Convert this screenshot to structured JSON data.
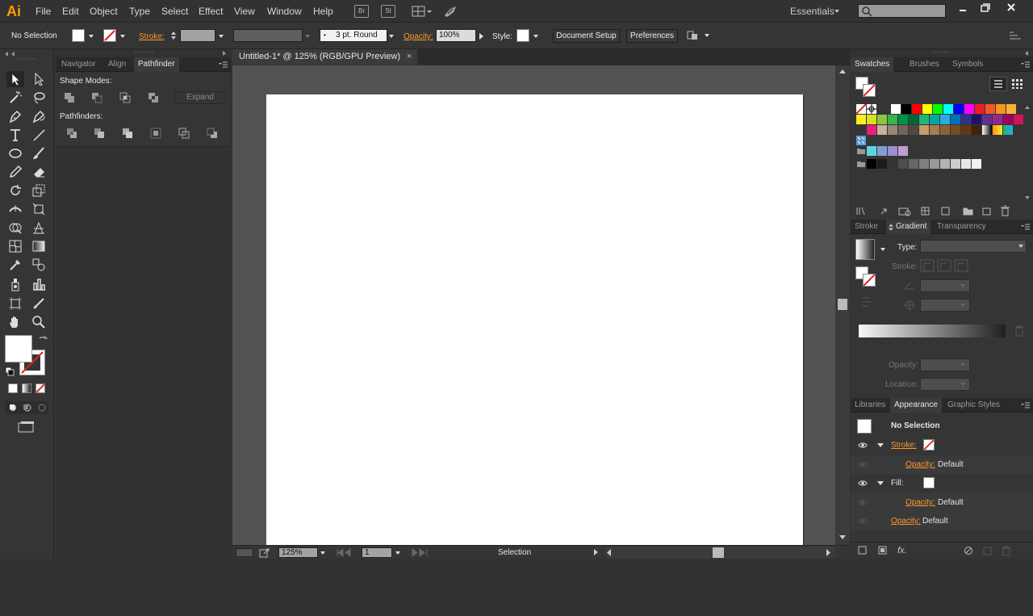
{
  "app": {
    "logo": "Ai"
  },
  "menu": [
    "File",
    "Edit",
    "Object",
    "Type",
    "Select",
    "Effect",
    "View",
    "Window",
    "Help"
  ],
  "menubar_icons": {
    "bridge": "Br",
    "stock": "St"
  },
  "workspace": "Essentials",
  "control": {
    "selection_label": "No Selection",
    "stroke_label": "Stroke:",
    "brush_label": "3 pt. Round",
    "opacity_label": "Opacity:",
    "opacity_value": "100%",
    "style_label": "Style:",
    "document_setup": "Document Setup",
    "preferences": "Preferences"
  },
  "left_panel": {
    "tabs": [
      "Navigator",
      "Align",
      "Pathfinder"
    ],
    "active_tab": "Pathfinder",
    "shape_modes_label": "Shape Modes:",
    "expand_label": "Expand",
    "pathfinders_label": "Pathfinders:"
  },
  "document": {
    "tab_title": "Untitled-1* @ 125% (RGB/GPU Preview)",
    "close": "×"
  },
  "status": {
    "zoom": "125%",
    "artboard": "1",
    "tool": "Selection"
  },
  "swatches_panel": {
    "tabs": [
      "Swatches",
      "Brushes",
      "Symbols"
    ],
    "active_tab": "Swatches",
    "rows": [
      [
        "#ffffff",
        "#000000",
        "#ff0000",
        "#ffff00",
        "#00ff00",
        "#00ffff",
        "#0000ff",
        "#ff00ff",
        "#ed1c24",
        "#f15a24",
        "#f7931e",
        "#fbb03b"
      ],
      [
        "#fcee21",
        "#d9e021",
        "#8cc63f",
        "#39b54a",
        "#009245",
        "#006837",
        "#22b573",
        "#00a99d",
        "#29abe2",
        "#0071bc",
        "#2e3192",
        "#1b1464",
        "#662d91",
        "#93278f",
        "#9e005d",
        "#d4145a"
      ],
      [
        "#ed1e79",
        "#c7b299",
        "#998675",
        "#736357",
        "#534741",
        "#c69c6d",
        "#a67c52",
        "#8c6239",
        "#754c24",
        "#603813",
        "#42210b",
        "#bdccd4"
      ],
      [
        "#5ed3de",
        "#7e9fd6",
        "#9b8fd1",
        "#c49cd6"
      ],
      [
        "#000000",
        "#1a1a1a",
        "#333333",
        "#4d4d4d",
        "#666666",
        "#808080",
        "#999999",
        "#b3b3b3",
        "#cccccc",
        "#e6e6e6",
        "#f2f2f2"
      ]
    ]
  },
  "gradient_panel": {
    "tabs": [
      "Stroke",
      "Gradient",
      "Transparency"
    ],
    "active_tab": "Gradient",
    "type_label": "Type:",
    "stroke_label": "Stroke:",
    "opacity_label": "Opacity:",
    "location_label": "Location:"
  },
  "appearance_panel": {
    "tabs": [
      "Libraries",
      "Appearance",
      "Graphic Styles"
    ],
    "active_tab": "Appearance",
    "title": "No Selection",
    "stroke_label": "Stroke:",
    "opacity_label": "Opacity:",
    "default_value": "Default",
    "fill_label": "Fill:",
    "fx_label": "fx."
  },
  "colors": {
    "accent": "#ff9a2e",
    "chrome": "#323232",
    "panel": "#353535",
    "canvas": "#535353",
    "artboard": "#ffffff",
    "none_red": "#e41e26"
  }
}
